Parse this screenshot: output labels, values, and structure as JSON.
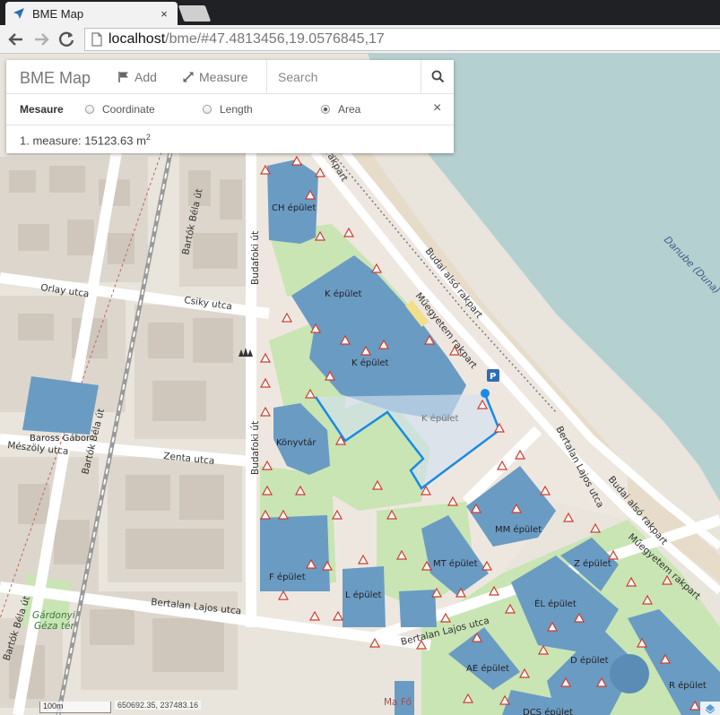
{
  "browser": {
    "tab_title": "BME Map",
    "tab_close": "×",
    "url_host": "localhost",
    "url_rest": "/bme/#47.4813456,19.0576845,17"
  },
  "panel": {
    "brand": "BME Map",
    "add_label": "Add",
    "measure_label": "Measure",
    "search_placeholder": "Search",
    "mode_title": "Mesaure",
    "modes": [
      {
        "label": "Coordinate",
        "selected": false
      },
      {
        "label": "Length",
        "selected": false
      },
      {
        "label": "Area",
        "selected": true
      }
    ],
    "close": "×",
    "result_text": "1. measure: 15123.63 m",
    "result_sup": "2"
  },
  "map": {
    "buildings": {
      "ch": "CH épület",
      "k1": "K épület",
      "k2": "K épület",
      "k3": "K épület",
      "konyvtar": "Könyvtár",
      "mm": "MM épület",
      "mt": "MT épület",
      "z": "Z épület",
      "f": "F épület",
      "l": "L épület",
      "el": "ÉL épület",
      "ae": "AE épület",
      "d": "D épület",
      "r": "R épület",
      "dcs": "DCS épület",
      "baross": "Baross Gábor"
    },
    "streets": {
      "bartok1": "Bartók Béla út",
      "bartok2": "Bartók Béla út",
      "bartok3": "Bartók Béla út",
      "orlay": "Orlay utca",
      "csiky": "Csiky utca",
      "meszoly": "Mészöly utca",
      "zenta": "Zenta utca",
      "budafoki1": "Budafoki út",
      "budafoki2": "Budafoki út",
      "budai1": "Budai alsó rakpart",
      "budai2": "Budai alsó rakpart",
      "muegyetem1": "Műegyetem rakpart",
      "muegyetem2": "Műegyetem rakpart",
      "bertalan1": "Bertalan Lajos utca",
      "bertalan2": "Bertalan Lajos utca",
      "bertalan3": "Bertalan Lajos utca",
      "rakpart_top": "rakpart",
      "gardonyi1": "Gárdonyi",
      "gardonyi2": "Géza tér",
      "duna": "Danube (Duna)",
      "mafi": "Ma Fő"
    },
    "parking": "P"
  },
  "status": {
    "scale": "100m",
    "coords": "650692.35, 237483.16"
  },
  "colors": {
    "water": "#b5d0d0",
    "building": "#6a9bc3",
    "green": "#c8e5b3",
    "measure": "#1a8be2"
  }
}
